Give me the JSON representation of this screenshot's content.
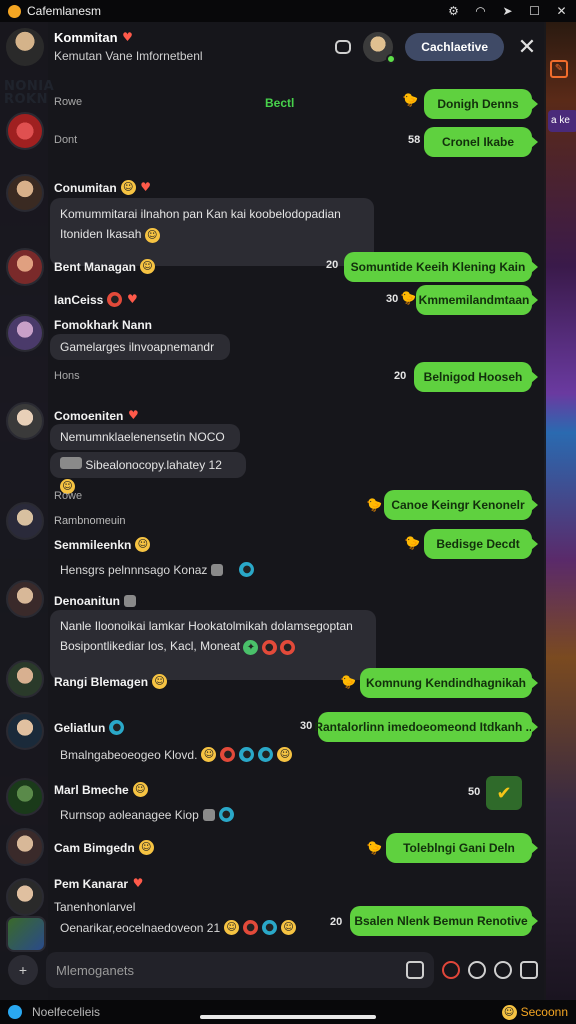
{
  "status_bar": {
    "app_title": "Cafemlanesm"
  },
  "background": {
    "logo_text": "NONIA\nROKN",
    "chip_text": "a ke"
  },
  "header": {
    "title": "Kommitan",
    "subtitle": "Kemutan Vane Imfornetbenl",
    "pill_label": "Cachlaetive"
  },
  "system_lines": {
    "line1": "Rowe",
    "line2": "Dont",
    "line3": "Hons",
    "line4": "Rowe",
    "green_label": "Bectl"
  },
  "messages": [
    {
      "kind": "out",
      "text": "Donigh Denns",
      "count": ""
    },
    {
      "kind": "out",
      "text": "Cronel Ikabe",
      "count": "58"
    },
    {
      "kind": "in",
      "name": "Conumitan",
      "lines": [
        "Komummitarai ilnahon pan Kan kai koobelodopadian",
        "Itoniden Ikasah"
      ]
    },
    {
      "kind": "in_name_only",
      "name": "Bent Managan"
    },
    {
      "kind": "out",
      "text": "Somuntide Keeih Klening Kain",
      "count": "20"
    },
    {
      "kind": "in_name_only",
      "name": "IanCeiss"
    },
    {
      "kind": "out",
      "text": "Kmmemilandmtaan",
      "count": "30"
    },
    {
      "kind": "in",
      "name": "Fomokhark Nann",
      "lines": [
        "Gamelarges ilnvoapnemandr"
      ]
    },
    {
      "kind": "out",
      "text": "Belnigod Hooseh",
      "count": "20"
    },
    {
      "kind": "in",
      "name": "Comoeniten",
      "lines": [
        "Nemumnklaelenensetin NOCO",
        "Sibealonocopy.lahatey 12"
      ]
    },
    {
      "kind": "out",
      "text": "Canoe Keingr Kenonelr",
      "count": ""
    },
    {
      "kind": "in",
      "name": "Semmileenkn",
      "sub": "Rambnomeuin",
      "lines": [
        "Hensgrs pelnnnsago Konaz"
      ]
    },
    {
      "kind": "out",
      "text": "Bedisge Decdt",
      "count": ""
    },
    {
      "kind": "in",
      "name": "Denoanitun",
      "lines": [
        "Nanle Iloonoikai lamkar Hookatolmikah dolamsegoptan",
        "Bosipontlikediar los, Kacl, Moneat"
      ]
    },
    {
      "kind": "in_name_only",
      "name": "Rangi Blemagen"
    },
    {
      "kind": "out",
      "text": "Komnung Kendindhagnikah",
      "count": ""
    },
    {
      "kind": "in",
      "name": "Geliatlun",
      "lines": [
        "Bmalngabeoeogeo Klovd."
      ]
    },
    {
      "kind": "out",
      "text": "Rantalorlinn imedoeomeond Itdkanh ...",
      "count": "30"
    },
    {
      "kind": "in",
      "name": "Marl Bmeche",
      "lines": [
        "Rurnsop aoleanagee Kiop"
      ]
    },
    {
      "kind": "out",
      "text": "",
      "count": "50"
    },
    {
      "kind": "in_name_only",
      "name": "Cam Bimgedn"
    },
    {
      "kind": "out",
      "text": "Toleblngi Gani Deln",
      "count": ""
    },
    {
      "kind": "in",
      "name": "Pem Kanarar",
      "sub": "Tanenhonlarvel",
      "lines": [
        "Oenarikar,eocelnaedoveon 21"
      ]
    },
    {
      "kind": "out",
      "text": "Bsalen Nlenk Bemun Renotive",
      "count": "20"
    }
  ],
  "input": {
    "placeholder": "Mlemoganets"
  },
  "bottom_bar": {
    "left_label": "Noelfecelieis",
    "right_label": "Secoonn"
  },
  "colors": {
    "panel": "#18181c",
    "bubble_out": "#5fd13f",
    "bubble_in": "#2c2c33",
    "pill": "#3f4a66"
  },
  "icons": [
    "settings-icon",
    "wifi-icon",
    "send-icon",
    "window-icon",
    "close-icon",
    "chat-icon",
    "close-icon",
    "plus-icon",
    "image-icon",
    "mic-icon",
    "sticker-icon",
    "clock-icon",
    "phone-icon"
  ]
}
